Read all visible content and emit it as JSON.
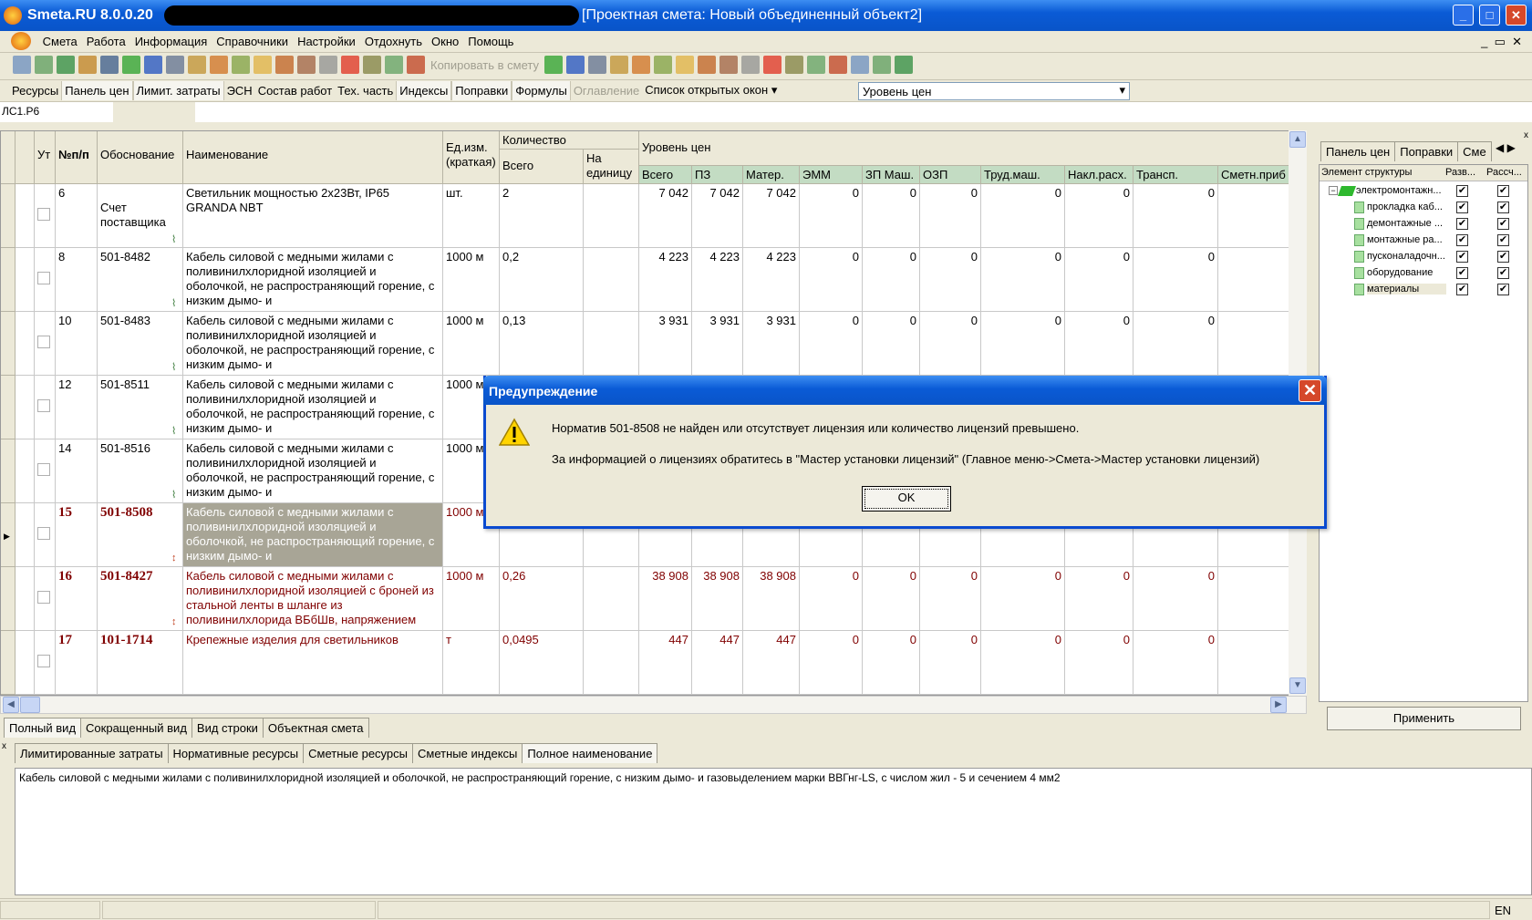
{
  "window": {
    "app": "Smeta.RU  8.0.0.20",
    "doc_title": "[Проектная смета: Новый объединенный объект2]",
    "min": "_",
    "max": "□",
    "close": "✕"
  },
  "menu": [
    "Смета",
    "Работа",
    "Информация",
    "Справочники",
    "Настройки",
    "Отдохнуть",
    "Окно",
    "Помощь"
  ],
  "toolbar": {
    "copy_label": "Копировать в смету",
    "icons": [
      "tree-icon",
      "tree-add-icon",
      "excel-icon",
      "find-icon",
      "save-icon",
      "refresh-icon",
      "undo-icon",
      "clipboard-icon",
      "resource-icon",
      "resource2-icon",
      "resource3-icon",
      "comment-icon",
      "coins-icon",
      "bricks-icon",
      "edit-icon",
      "delete-icon",
      "calc-icon",
      "calc-add-icon",
      "up-down-icon"
    ],
    "icons2": [
      "copy-icon",
      "paste-icon",
      "ls-icon",
      "p-icon",
      "pr-icon",
      "tree-check-icon",
      "tree-delete-icon",
      "indent-icon",
      "outdent-icon",
      "indent2-icon",
      "outdent2-icon",
      "tools-icon",
      "truck-icon",
      "hill-icon",
      "car-icon",
      "books-icon",
      "book-icon"
    ]
  },
  "panel_bar": {
    "items": [
      {
        "label": "Ресурсы",
        "pressed": false
      },
      {
        "label": "Панель цен",
        "pressed": true
      },
      {
        "label": "Лимит. затраты",
        "pressed": true
      },
      {
        "label": "ЭСН",
        "pressed": false
      },
      {
        "label": "Состав работ",
        "pressed": false
      },
      {
        "label": "Тех. часть",
        "pressed": false
      },
      {
        "label": "Индексы",
        "pressed": true
      },
      {
        "label": "Поправки",
        "pressed": true
      },
      {
        "label": "Формулы",
        "pressed": true
      },
      {
        "label": "Оглавление",
        "disabled": true
      },
      {
        "label": "Список открытых окон ▾",
        "pressed": false
      }
    ],
    "level_value": "Уровень цен"
  },
  "path": "ЛС1.Р6",
  "grid": {
    "headers": {
      "ut": "Ут",
      "num": "№п/п",
      "basis": "Обоснование",
      "name": "Наименование",
      "unit": "Ед.изм. (краткая)",
      "qty": "Количество",
      "qty_total": "Всего",
      "qty_unit": "На единицу",
      "price_level": "Уровень цен",
      "price_cols": [
        "Всего",
        "ПЗ",
        "Матер.",
        "ЭММ",
        "ЗП Маш.",
        "ОЗП",
        "Труд.маш.",
        "Накл.расх.",
        "Трансп.",
        "Сметн.приб"
      ]
    },
    "rows": [
      {
        "num": "6",
        "basis": "Счет поставщика",
        "name": "Светильник мощностью 2х23Вт, IP65 GRANDA NBT",
        "unit": "шт.",
        "qty": "2",
        "prices": [
          "7 042",
          "7 042",
          "7 042",
          "0",
          "0",
          "0",
          "0",
          "0",
          "0",
          ""
        ],
        "style": "normal",
        "icon": "clip"
      },
      {
        "num": "8",
        "basis": "501-8482",
        "name": "Кабель силовой с медными жилами с поливинилхлоридной изоляцией и оболочкой, не распространяющий горение, с низким дымо- и",
        "unit": "1000 м",
        "qty": "0,2",
        "prices": [
          "4 223",
          "4 223",
          "4 223",
          "0",
          "0",
          "0",
          "0",
          "0",
          "0",
          ""
        ],
        "style": "normal",
        "icon": "clip"
      },
      {
        "num": "10",
        "basis": "501-8483",
        "name": "Кабель силовой с медными жилами с поливинилхлоридной изоляцией и оболочкой, не распространяющий горение, с низким дымо- и",
        "unit": "1000 м",
        "qty": "0,13",
        "prices": [
          "3 931",
          "3 931",
          "3 931",
          "0",
          "0",
          "0",
          "0",
          "0",
          "0",
          ""
        ],
        "style": "normal",
        "icon": "clip"
      },
      {
        "num": "12",
        "basis": "501-8511",
        "name": "Кабель силовой с медными жилами с поливинилхлоридной изоляцией и оболочкой, не распространяющий горение, с низким дымо- и",
        "unit": "1000 м",
        "qty": "",
        "prices": [
          "",
          "",
          "",
          "",
          "",
          "",
          "",
          "",
          "",
          ""
        ],
        "style": "normal",
        "icon": "clip"
      },
      {
        "num": "14",
        "basis": "501-8516",
        "name": "Кабель силовой с медными жилами с поливинилхлоридной изоляцией и оболочкой, не распространяющий горение, с низким дымо- и",
        "unit": "1000 м",
        "qty": "",
        "prices": [
          "",
          "",
          "",
          "",
          "",
          "",
          "",
          "",
          "",
          ""
        ],
        "style": "normal",
        "icon": "clip"
      },
      {
        "num": "15",
        "basis": "501-8508",
        "name": "Кабель силовой с медными жилами с поливинилхлоридной изоляцией и оболочкой, не распространяющий горение, с низким дымо- и",
        "unit": "1000 м",
        "qty": "",
        "prices": [
          "",
          "",
          "",
          "",
          "",
          "",
          "",
          "",
          "",
          ""
        ],
        "style": "red",
        "selected": true,
        "icon": "updown"
      },
      {
        "num": "16",
        "basis": "501-8427",
        "name": "Кабель силовой с медными жилами с поливинилхлоридной изоляцией с броней из стальной ленты в шланге из поливинилхлорида ВБбШв, напряжением",
        "unit": "1000 м",
        "qty": "0,26",
        "prices": [
          "38 908",
          "38 908",
          "38 908",
          "0",
          "0",
          "0",
          "0",
          "0",
          "0",
          ""
        ],
        "style": "red",
        "icon": "updown"
      },
      {
        "num": "17",
        "basis": "101-1714",
        "name": "Крепежные изделия для светильников",
        "unit": "т",
        "qty": "0,0495",
        "prices": [
          "447",
          "447",
          "447",
          "0",
          "0",
          "0",
          "0",
          "0",
          "0",
          ""
        ],
        "style": "red",
        "icon": ""
      }
    ]
  },
  "view_tabs": [
    {
      "label": "Полный вид",
      "active": true
    },
    {
      "label": "Сокращенный вид"
    },
    {
      "label": "Вид строки"
    },
    {
      "label": "Объектная смета"
    }
  ],
  "bottom_tabs": [
    {
      "label": "Лимитированные затраты"
    },
    {
      "label": "Нормативные ресурсы"
    },
    {
      "label": "Сметные ресурсы"
    },
    {
      "label": "Сметные индексы"
    },
    {
      "label": "Полное наименование",
      "active": true
    }
  ],
  "full_name": "Кабель силовой с медными жилами с поливинилхлоридной изоляцией и оболочкой, не распространяющий горение, с низким дымо- и газовыделением марки ВВГнг-LS, с числом жил - 5 и сечением 4 мм2",
  "right_panel": {
    "tabs": [
      "Панель цен",
      "Поправки",
      "Сме"
    ],
    "cols": [
      "Элемент структуры",
      "Разв...",
      "Рассч..."
    ],
    "items": [
      {
        "label": "электромонтажн...",
        "root": true
      },
      {
        "label": "прокладка каб..."
      },
      {
        "label": "демонтажные ..."
      },
      {
        "label": "монтажные ра..."
      },
      {
        "label": "пусконаладочн..."
      },
      {
        "label": "оборудование"
      },
      {
        "label": "материалы",
        "selected": true
      }
    ],
    "apply": "Применить"
  },
  "status": {
    "lang": "EN"
  },
  "dialog": {
    "title": "Предупреждение",
    "line1": "Норматив 501-8508 не найден или отсутствует лицензия или количество лицензий превышено.",
    "line2": "За информацией о лицензиях обратитесь в \"Мастер установки лицензий\" (Главное меню->Смета->Мастер установки лицензий)",
    "ok": "OK",
    "icon": "warning-icon"
  },
  "colors": {
    "titlebar": "#0a5bd6",
    "header_green": "#c3dcc3",
    "error_row": "#800000",
    "selected_cell": "#a8a596"
  }
}
